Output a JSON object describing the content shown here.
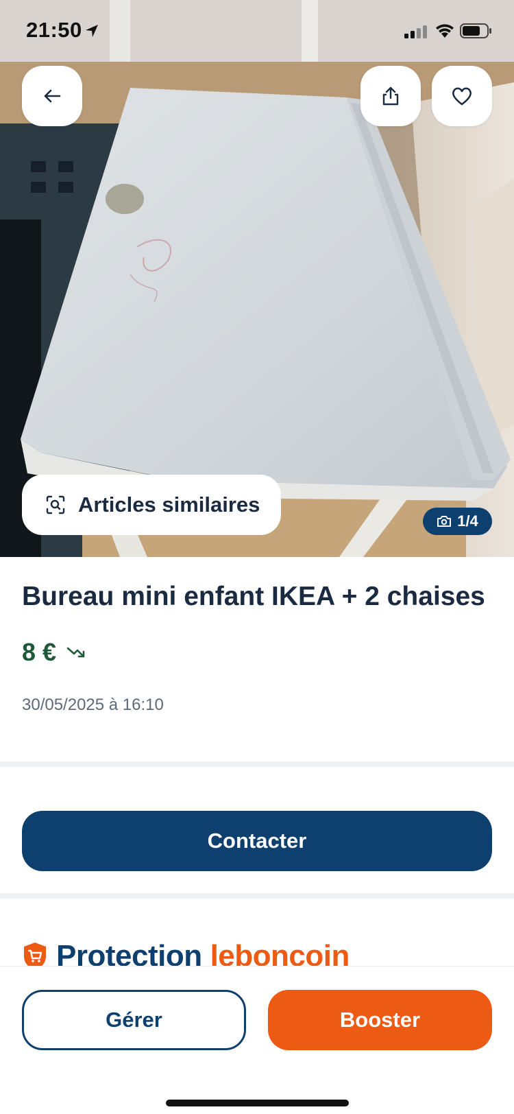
{
  "status_bar": {
    "time": "21:50"
  },
  "hero": {
    "photo_alt": "Photo de l'annonce",
    "similar_label": "Articles similaires",
    "photo_counter": "1/4"
  },
  "listing": {
    "title": "Bureau mini enfant IKEA + 2 chaises",
    "price": "8 €",
    "date": "30/05/2025 à 16:10"
  },
  "actions": {
    "contact_label": "Contacter",
    "manage_label": "Gérer",
    "boost_label": "Booster"
  },
  "protection": {
    "brand_part1": "Protection",
    "brand_part2": "leboncoin"
  },
  "colors": {
    "primary_blue": "#0d3f6f",
    "accent_orange": "#ec5a13",
    "price_green": "#1e5a3a"
  },
  "icons": {
    "back": "arrow-left-icon",
    "share": "share-icon",
    "favorite": "heart-icon",
    "similar": "visual-search-icon",
    "camera": "camera-icon",
    "price_drop": "price-drop-icon"
  }
}
